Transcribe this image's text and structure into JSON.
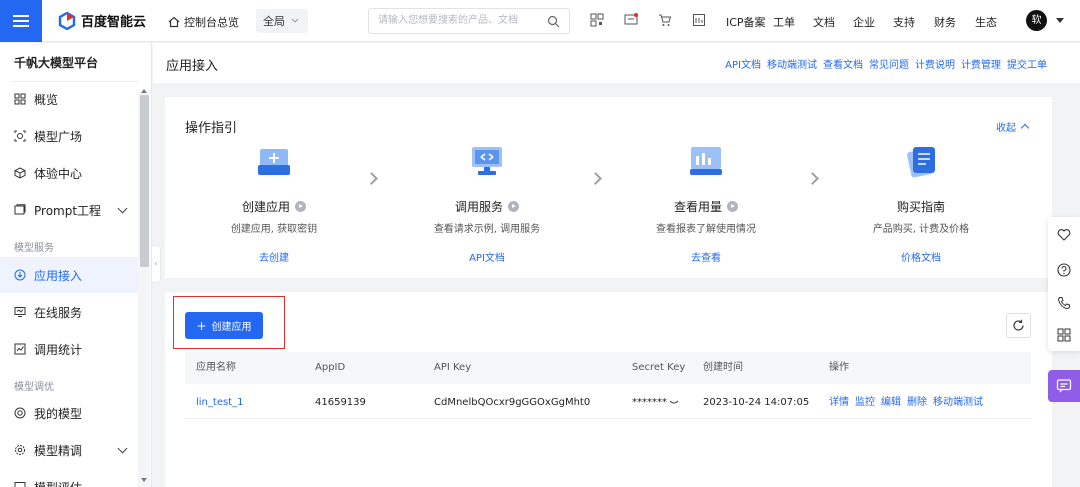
{
  "topbar": {
    "brand": "百度智能云",
    "home_label": "控制台总览",
    "region": "全局",
    "search_placeholder": "请输入您想要搜索的产品、文档",
    "nav": [
      "ICP备案",
      "工单",
      "文档",
      "企业",
      "支持",
      "财务",
      "生态"
    ],
    "avatar_text": "软"
  },
  "sidebar": {
    "title": "千帆大模型平台",
    "items": [
      {
        "label": "概览",
        "icon": "grid-icon"
      },
      {
        "label": "模型广场",
        "icon": "model-icon"
      },
      {
        "label": "体验中心",
        "icon": "cube-icon"
      },
      {
        "label": "Prompt工程",
        "icon": "prompt-icon"
      }
    ],
    "section_model_service": "模型服务",
    "service_items": [
      {
        "label": "应用接入",
        "icon": "link-icon"
      },
      {
        "label": "在线服务",
        "icon": "monitor-icon"
      },
      {
        "label": "调用统计",
        "icon": "chart-icon"
      }
    ],
    "section_model_tuning": "模型调优",
    "tuning_items": [
      {
        "label": "我的模型",
        "icon": "target-icon"
      },
      {
        "label": "模型精调",
        "icon": "settings-icon"
      },
      {
        "label": "模型评估",
        "icon": "eval-icon"
      }
    ]
  },
  "page": {
    "title": "应用接入",
    "links": [
      "API文档",
      "移动端测试",
      "查看文档",
      "常见问题",
      "计费说明",
      "计费管理",
      "提交工单"
    ]
  },
  "guide": {
    "title": "操作指引",
    "collapse_label": "收起",
    "steps": [
      {
        "title": "创建应用",
        "desc": "创建应用, 获取密钥",
        "link": "去创建"
      },
      {
        "title": "调用服务",
        "desc": "查看请求示例, 调用服务",
        "link": "API文档"
      },
      {
        "title": "查看用量",
        "desc": "查看报表了解使用情况",
        "link": "去查看"
      },
      {
        "title": "购买指南",
        "desc": "产品购买, 计费及价格",
        "link": "价格文档"
      }
    ]
  },
  "apps": {
    "create_label": "创建应用",
    "columns": [
      "应用名称",
      "AppID",
      "API Key",
      "Secret Key",
      "创建时间",
      "操作"
    ],
    "rows": [
      {
        "name": "lin_test_1",
        "app_id": "41659139",
        "api_key": "CdMnelbQOcxr9gGGOxGgMht0",
        "secret_key": "*******",
        "created": "2023-10-24 14:07:05",
        "ops": [
          "详情",
          "监控",
          "编辑",
          "删除",
          "移动端测试"
        ]
      }
    ]
  },
  "colors": {
    "accent": "#2468f2",
    "highlight": "#e0302c",
    "chat": "#8f5de8"
  }
}
